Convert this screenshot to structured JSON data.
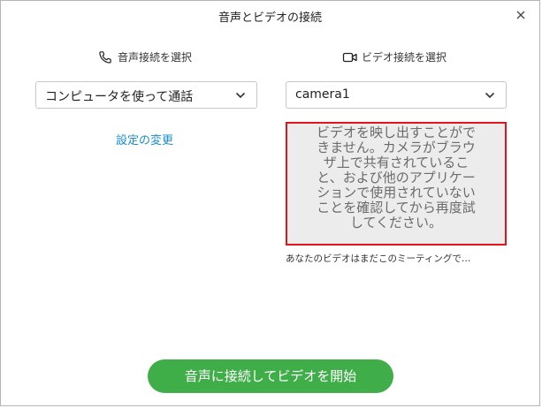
{
  "dialog": {
    "title": "音声とビデオの接続"
  },
  "audio": {
    "label": "音声接続を選択",
    "selected": "コンピュータを使って通話",
    "settings_link": "設定の変更"
  },
  "video": {
    "label": "ビデオ接続を選択",
    "selected": "camera1",
    "error_message": "ビデオを映し出すことができません。カメラがブラウザ上で共有されていること、および他のアプリケーションで使用されていないことを確認してから再度試してください。",
    "note": "あなたのビデオはまだこのミーティングで…"
  },
  "actions": {
    "primary_label": "音声に接続してビデオを開始"
  },
  "colors": {
    "accent_green": "#3fae49",
    "link_blue": "#1a8fce",
    "error_red": "#e0161b"
  },
  "icons": {
    "close": "close-icon",
    "phone": "phone-icon",
    "camera": "video-camera-icon",
    "chevron": "chevron-down-icon"
  }
}
